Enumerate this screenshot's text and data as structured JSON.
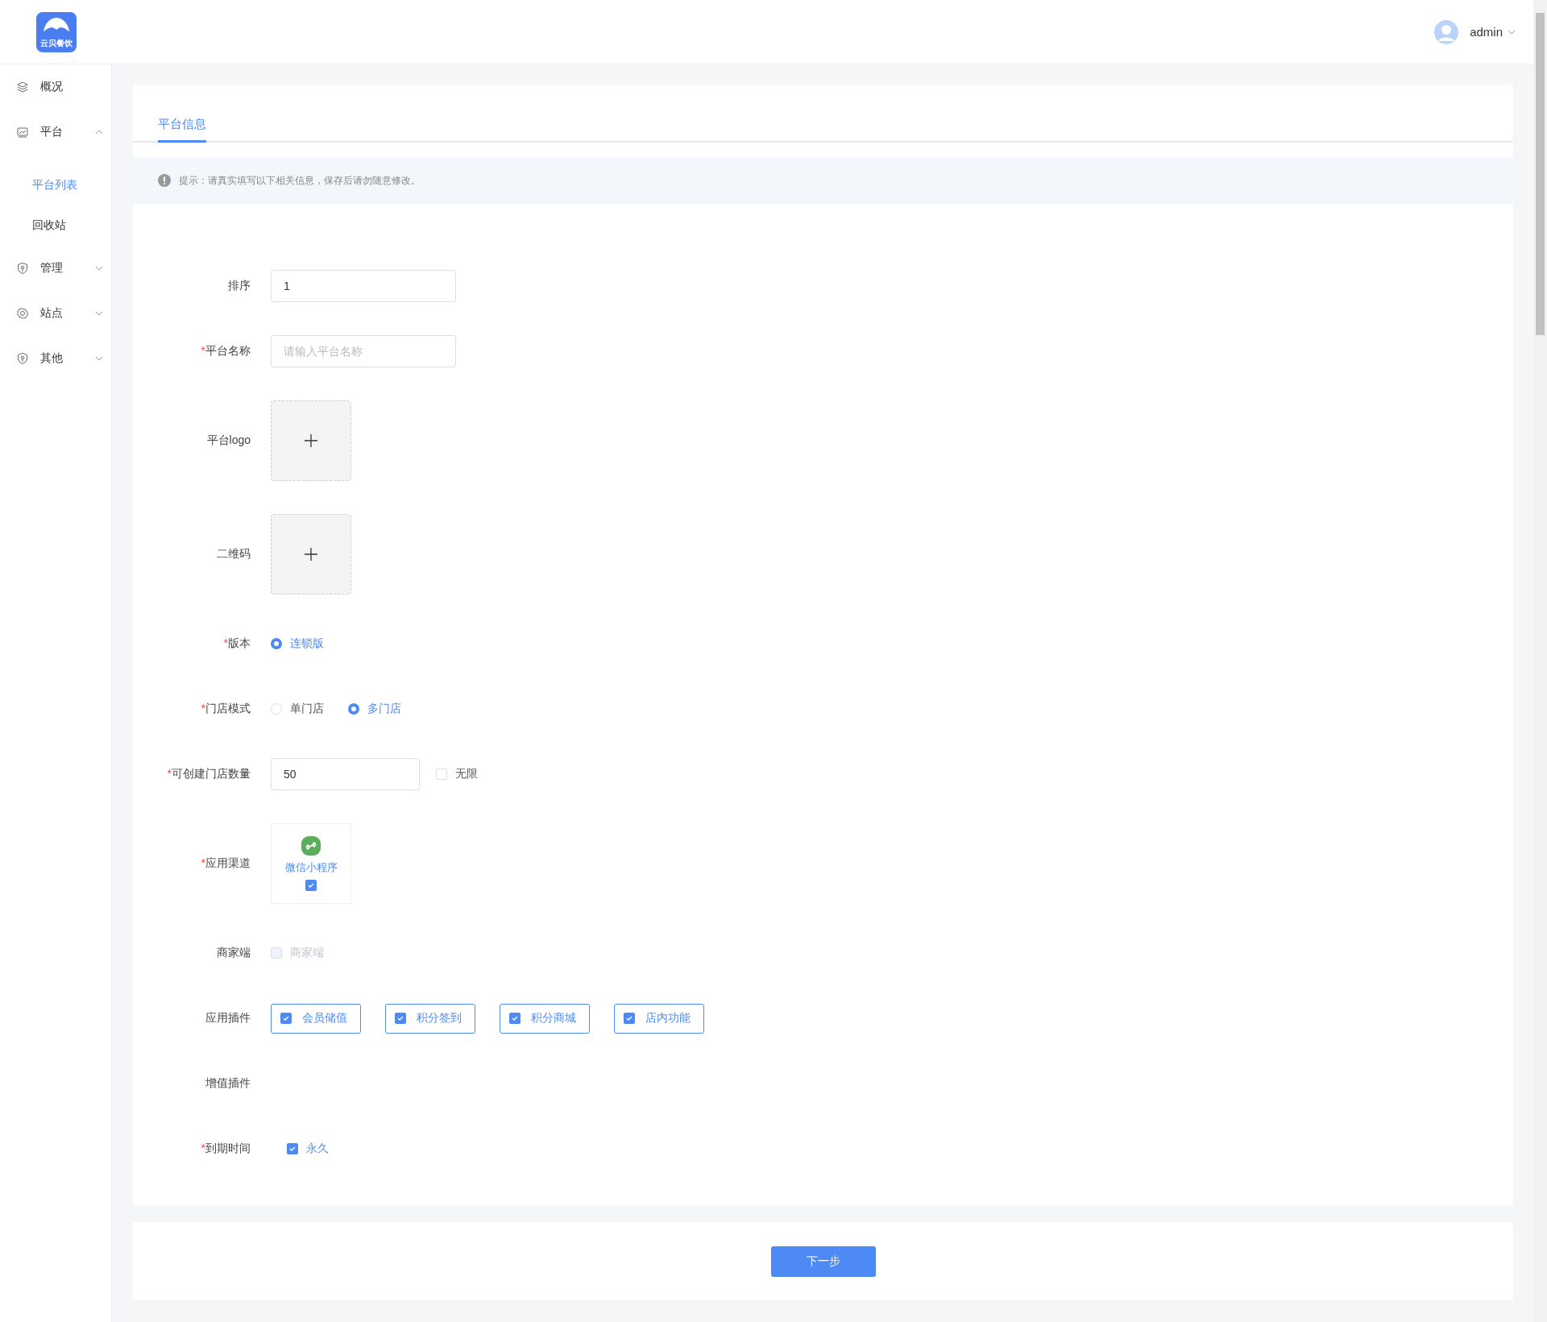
{
  "header": {
    "logo_text": "云贝餐饮",
    "user": "admin"
  },
  "sidebar": {
    "items": [
      {
        "label": "概况"
      },
      {
        "label": "平台",
        "expanded": true,
        "children": [
          {
            "label": "平台列表",
            "selected": true
          },
          {
            "label": "回收站",
            "selected": false
          }
        ]
      },
      {
        "label": "管理",
        "expanded": false
      },
      {
        "label": "站点",
        "expanded": false
      },
      {
        "label": "其他",
        "expanded": false
      }
    ]
  },
  "tabs": [
    {
      "label": "平台信息",
      "selected": true
    }
  ],
  "hint": "提示：请真实填写以下相关信息，保存后请勿随意修改。",
  "form": {
    "fields": [
      {
        "kind": "input",
        "label": "排序",
        "value": "1"
      },
      {
        "kind": "input",
        "label": "平台名称",
        "required_mark": "*",
        "placeholder": "请输入平台名称"
      },
      {
        "kind": "upload",
        "label": "平台logo"
      },
      {
        "kind": "upload",
        "label": "二维码"
      },
      {
        "kind": "radio",
        "label": "版本",
        "required_mark": "*",
        "options": [
          {
            "label": "连锁版",
            "selected": true
          }
        ]
      },
      {
        "kind": "radio",
        "label": "门店模式",
        "required_mark": "*",
        "options": [
          {
            "label": "单门店",
            "selected": false
          },
          {
            "label": "多门店",
            "selected": true
          }
        ]
      },
      {
        "kind": "count",
        "label": "可创建门店数量",
        "required_mark": "*",
        "value": "50",
        "option": {
          "label": "无限",
          "checked": false
        }
      },
      {
        "kind": "channel",
        "label": "应用渠道",
        "required_mark": "*",
        "channels": [
          {
            "label": "微信小程序",
            "checked": true
          }
        ]
      },
      {
        "kind": "checkbox",
        "label": "商家端",
        "options": [
          {
            "label": "商家端",
            "checked": false,
            "disabled": true
          }
        ]
      },
      {
        "kind": "tags",
        "label": "应用插件",
        "options": [
          {
            "label": "会员储值",
            "checked": true
          },
          {
            "label": "积分签到",
            "checked": true
          },
          {
            "label": "积分商城",
            "checked": true
          },
          {
            "label": "店内功能",
            "checked": true
          }
        ]
      },
      {
        "kind": "tags",
        "label": "增值插件"
      },
      {
        "kind": "checkbox",
        "label": "到期时间",
        "required_mark": "*",
        "options": [
          {
            "label": "永久",
            "checked": true,
            "disabled": false
          }
        ]
      }
    ]
  },
  "footer": {
    "button": "下一步"
  }
}
